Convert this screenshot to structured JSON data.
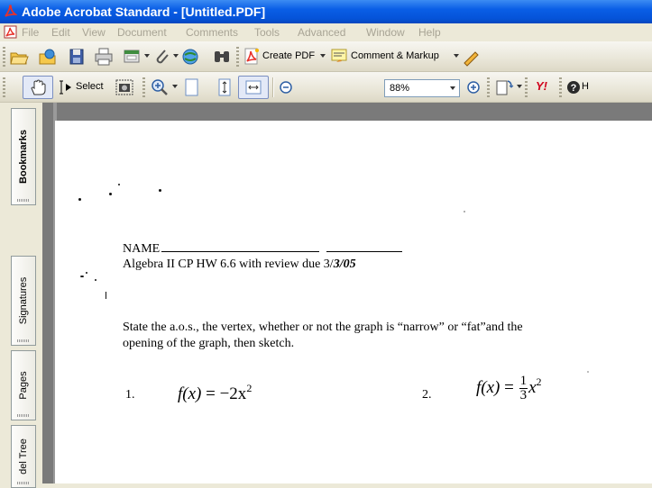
{
  "window": {
    "title": "Adobe Acrobat Standard - [Untitled.PDF]"
  },
  "menu": {
    "items": [
      "File",
      "Edit",
      "View",
      "Document",
      "Comments",
      "Tools",
      "Advanced",
      "Window",
      "Help"
    ]
  },
  "toolbar1": {
    "create_pdf_label": "Create PDF",
    "comment_markup_label": "Comment & Markup",
    "icons": [
      "open-folder-icon",
      "organizer-icon",
      "save-icon",
      "print-icon",
      "email-icon",
      "attach-icon",
      "web-capture-icon",
      "find-binoculars-icon",
      "create-pdf-icon",
      "comment-markup-icon"
    ]
  },
  "toolbar2": {
    "select_label": "Select",
    "zoom_value": "88%",
    "help_label": "H",
    "yahoo_label": "Y!",
    "icons": [
      "hand-tool-icon",
      "select-text-icon",
      "snapshot-icon",
      "zoom-in-icon",
      "single-page-icon",
      "fit-height-icon",
      "fit-width-icon",
      "zoom-out-minus-icon",
      "zoom-in-plus-icon",
      "rotate-page-icon",
      "yahoo-icon",
      "help-icon"
    ]
  },
  "nav_tabs": [
    {
      "label": "Bookmarks",
      "active": true
    },
    {
      "label": "Signatures",
      "active": false
    },
    {
      "label": "Pages",
      "active": false
    },
    {
      "label": "del Tree",
      "active": false
    }
  ],
  "document": {
    "name_line": "NAME",
    "header_line": "Algebra II CP   HW   6.6 with review   due 3/",
    "header_date_tail": "3/05",
    "instructions_line1": "State the a.o.s., the vertex, whether or not the graph is “narrow” or “fat”and  the",
    "instructions_line2": "opening of the graph, then sketch.",
    "problems": [
      {
        "number": "1.",
        "lhs": "f(x)",
        "rhs": "= −2x",
        "exp": "2"
      },
      {
        "number": "2.",
        "lhs": "f(x)",
        "rhs_prefix": "=",
        "frac_num": "1",
        "frac_den": "3",
        "rhs_suffix": "x",
        "exp": "2"
      }
    ]
  },
  "colors": {
    "titlebar": "#0a5ee6",
    "chrome": "#ece9d8",
    "doc_background": "#7a7a7a",
    "page": "#ffffff"
  }
}
